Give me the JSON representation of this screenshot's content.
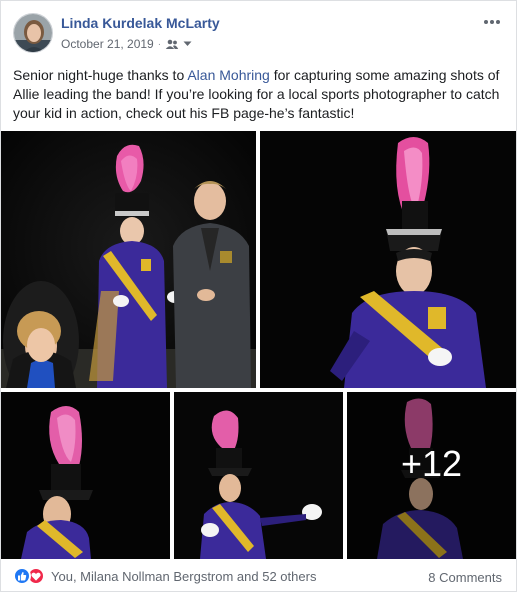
{
  "post": {
    "author": "Linda Kurdelak McLarty",
    "date": "October 21, 2019",
    "privacy_icon": "friends-icon",
    "text_before": "Senior night-huge thanks to ",
    "mention": "Alan Mohring",
    "text_after": " for capturing some amazing shots of Allie leading the band! If you’re looking for a local sports photographer to catch your kid in action, check out his FB page-he’s fantastic!",
    "more_photos": "+12"
  },
  "footer": {
    "reactions_text": "You, Milana Nollman Bergstrom and 52 others",
    "comments": "8 Comments"
  },
  "colors": {
    "link": "#385898",
    "secondary_text": "#616770",
    "like_blue": "#2078f4",
    "love_red": "#f0284a",
    "uniform_purple": "#3b2a9a",
    "plume_pink": "#e85aa8",
    "gold": "#e0b82a"
  }
}
